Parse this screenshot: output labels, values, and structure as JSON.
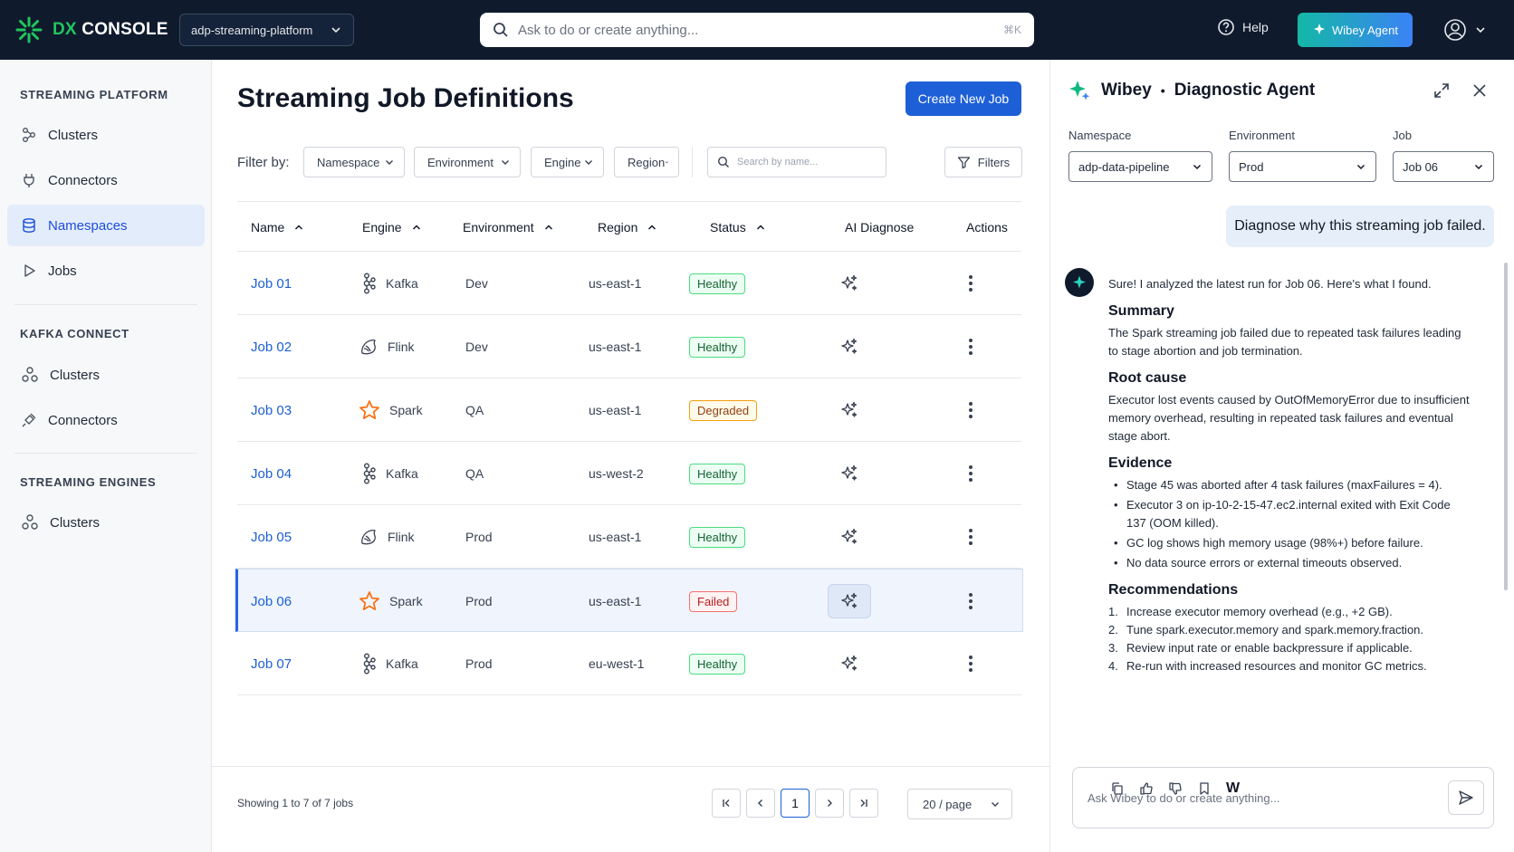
{
  "app": {
    "logo_accent": "DX",
    "logo_rest": "CONSOLE"
  },
  "topbar": {
    "namespace_value": "adp-streaming-platform",
    "search_placeholder": "Ask to do or create anything...",
    "search_shortcut": "⌘K",
    "help_label": "Help",
    "agent_label": "Wibey Agent"
  },
  "sidebar": {
    "sections": [
      {
        "title": "STREAMING PLATFORM",
        "items": [
          {
            "label": "Clusters",
            "icon": "clusters-icon"
          },
          {
            "label": "Connectors",
            "icon": "plug-icon"
          },
          {
            "label": "Namespaces",
            "icon": "database-icon",
            "active": true
          },
          {
            "label": "Jobs",
            "icon": "play-icon"
          }
        ]
      },
      {
        "title": "KAFKA CONNECT",
        "items": [
          {
            "label": "Clusters",
            "icon": "clusters-icon"
          },
          {
            "label": "Connectors",
            "icon": "plug-icon"
          }
        ]
      },
      {
        "title": "STREAMING ENGINES",
        "items": [
          {
            "label": "Clusters",
            "icon": "clusters-icon"
          }
        ]
      }
    ]
  },
  "main": {
    "title": "Streaming Job Definitions",
    "create_label": "Create New Job",
    "filter_label": "Filter by:",
    "filters": [
      "Namespace",
      "Environment",
      "Engine",
      "Region"
    ],
    "search_placeholder": "Search by name...",
    "filters_button": "Filters",
    "columns": [
      "Name",
      "Engine",
      "Environment",
      "Region",
      "Status",
      "AI Diagnose",
      "Actions"
    ],
    "rows": [
      {
        "name": "Job 01",
        "engine": "Kafka",
        "env": "Dev",
        "region": "us-east-1",
        "status": "Healthy"
      },
      {
        "name": "Job 02",
        "engine": "Flink",
        "env": "Dev",
        "region": "us-east-1",
        "status": "Healthy"
      },
      {
        "name": "Job 03",
        "engine": "Spark",
        "env": "QA",
        "region": "us-east-1",
        "status": "Degraded"
      },
      {
        "name": "Job 04",
        "engine": "Kafka",
        "env": "QA",
        "region": "us-west-2",
        "status": "Healthy"
      },
      {
        "name": "Job 05",
        "engine": "Flink",
        "env": "Prod",
        "region": "us-east-1",
        "status": "Healthy"
      },
      {
        "name": "Job 06",
        "engine": "Spark",
        "env": "Prod",
        "region": "us-east-1",
        "status": "Failed",
        "selected": true
      },
      {
        "name": "Job 07",
        "engine": "Kafka",
        "env": "Prod",
        "region": "eu-west-1",
        "status": "Healthy"
      }
    ],
    "showing": "Showing 1 to 7 of 7 jobs",
    "current_page": "1",
    "per_page": "20 / page"
  },
  "panel": {
    "title_brand": "Wibey",
    "title_sep": "•",
    "title_agent": "Diagnostic Agent",
    "namespace_label": "Namespace",
    "namespace_value": "adp-data-pipeline",
    "environment_label": "Environment",
    "environment_value": "Prod",
    "job_label": "Job",
    "job_value": "Job 06",
    "user_message": "Diagnose why this streaming job failed.",
    "intro": "Sure! I analyzed the latest run for Job 06. Here's what I found.",
    "summary_title": "Summary",
    "summary_text": "The Spark streaming job failed due to repeated task failures leading to stage abortion and job termination.",
    "root_title": "Root cause",
    "root_text": "Executor lost events caused by OutOfMemoryError due to insufficient memory overhead, resulting in repeated task failures and eventual stage abort.",
    "evidence_title": "Evidence",
    "evidence": [
      "Stage 45 was aborted after 4 task failures (maxFailures = 4).",
      "Executor 3 on ip-10-2-15-47.ec2.internal exited with Exit Code 137 (OOM killed).",
      "GC log shows high memory usage (98%+) before failure.",
      "No data source errors or external timeouts observed."
    ],
    "rec_title": "Recommendations",
    "recommendations": [
      "Increase executor memory overhead (e.g., +2 GB).",
      "Tune spark.executor.memory and spark.memory.fraction.",
      "Review input rate or enable backpressure if applicable.",
      "Re-run with increased resources and monitor GC metrics."
    ],
    "wlogo": "W",
    "chat_placeholder": "Ask Wibey to do or create anything..."
  },
  "colors": {
    "topbar": "#0f1b2d",
    "accent": "#1d5fd6",
    "healthy": "#166534",
    "degraded": "#92400e",
    "failed": "#b91c1c"
  }
}
